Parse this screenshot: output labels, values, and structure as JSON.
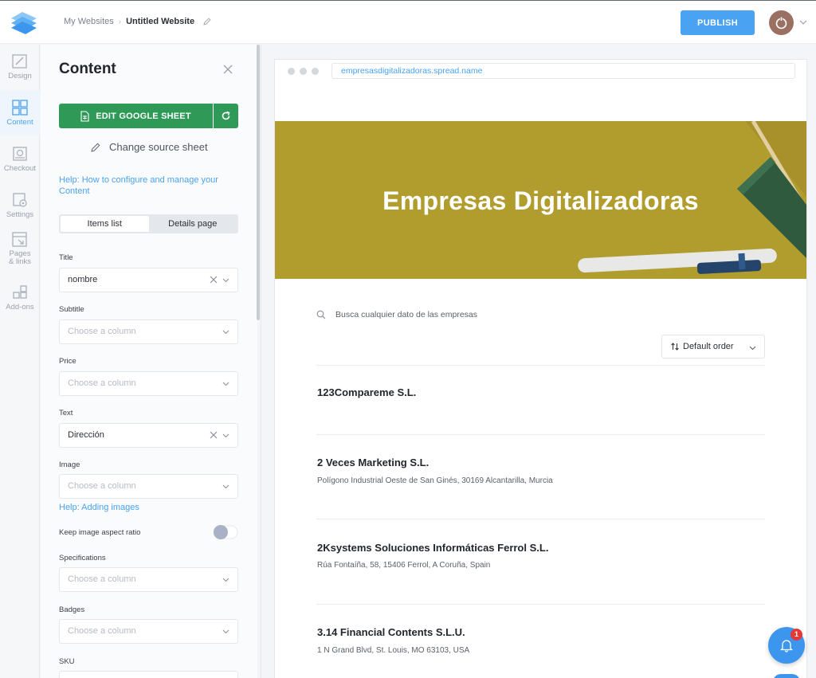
{
  "topbar": {
    "breadcrumb_parent": "My Websites",
    "breadcrumb_separator": "›",
    "breadcrumb_current": "Untitled Website",
    "publish_label": "PUBLISH",
    "accent_color": "#4aa2f2"
  },
  "nav": {
    "items": [
      {
        "label": "Design",
        "icon": "design-icon"
      },
      {
        "label": "Content",
        "icon": "content-grid-icon",
        "active": true
      },
      {
        "label": "Checkout",
        "icon": "checkout-icon"
      },
      {
        "label": "Settings",
        "icon": "settings-icon"
      },
      {
        "label": "Pages & links",
        "icon": "pages-icon"
      },
      {
        "label": "Add-ons",
        "icon": "addons-icon"
      }
    ]
  },
  "panel": {
    "title": "Content",
    "google_sheet_label": "EDIT GOOGLE SHEET",
    "google_sheet_color": "#2f9a57",
    "change_source_label": "Change source sheet",
    "help_link": "Help: How to configure and manage your Content",
    "tabs": [
      "Items list",
      "Details page"
    ],
    "active_tab": "Items list",
    "fields": {
      "title": {
        "label": "Title",
        "value": "nombre"
      },
      "subtitle": {
        "label": "Subtitle",
        "placeholder": "Choose a column"
      },
      "price": {
        "label": "Price",
        "placeholder": "Choose a column"
      },
      "text": {
        "label": "Text",
        "value": "Dirección"
      },
      "image": {
        "label": "Image",
        "placeholder": "Choose a column"
      },
      "specifications": {
        "label": "Specifications",
        "placeholder": "Choose a column"
      },
      "badges": {
        "label": "Badges",
        "placeholder": "Choose a column"
      },
      "sku": {
        "label": "SKU"
      }
    },
    "help_images": "Help: Adding images",
    "aspect_ratio_label": "Keep image aspect ratio",
    "aspect_ratio_on": false
  },
  "preview": {
    "url": "empresasdigitalizadoras.spread.name",
    "hero_title": "Empresas Digitalizadoras",
    "hero_color": "#b19c2e",
    "search_placeholder": "Busca cualquier dato de las empresas",
    "order_label": "Default order",
    "items": [
      {
        "title": "123Compareme S.L.",
        "subtitle": ""
      },
      {
        "title": "2 Veces Marketing S.L.",
        "subtitle": "Polígono Industrial Oeste de San Ginés, 30169 Alcantarilla, Murcia"
      },
      {
        "title": "2Ksystems Soluciones Informáticas Ferrol S.L.",
        "subtitle": "Rúa Fontaíña, 58, 15406 Ferrol, A Coruña, Spain"
      },
      {
        "title": "3.14 Financial Contents S.L.U.",
        "subtitle": "1 N Grand Blvd, St. Louis, MO 63103, USA"
      }
    ]
  },
  "notifications": {
    "count": "1"
  }
}
